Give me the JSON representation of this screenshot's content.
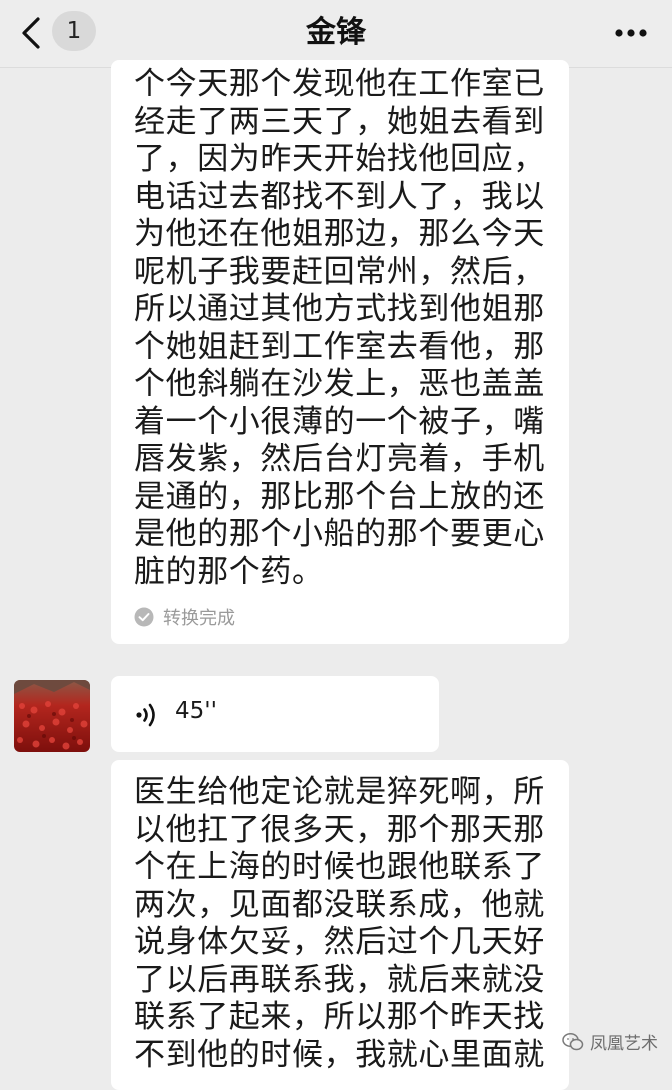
{
  "header": {
    "unread_count": "1",
    "title": "金锋"
  },
  "messages": [
    {
      "type": "transcript",
      "text": "个今天那个发现他在工作室已经走了两三天了，她姐去看到了，因为昨天开始找他回应，电话过去都找不到人了，我以为他还在他姐那边，那么今天呢机子我要赶回常州，然后，所以通过其他方式找到他姐那个她姐赶到工作室去看他，那个他斜躺在沙发上，恶也盖盖着一个小很薄的一个被子，嘴唇发紫，然后台灯亮着，手机是通的，那比那个台上放的还是他的那个小船的那个要更心脏的那个药。",
      "status": "转换完成"
    },
    {
      "type": "voice",
      "duration": "45''"
    },
    {
      "type": "transcript",
      "text": "医生给他定论就是猝死啊，所以他扛了很多天，那个那天那个在上海的时候也跟他联系了两次，见面都没联系成，他就说身体欠妥，然后过个几天好了以后再联系我，就后来就没联系了起来，所以那个昨天找不到他的时候，我就心里面就"
    }
  ],
  "watermark": "凤凰艺术",
  "icons": [
    "back-chevron-icon",
    "more-options-icon",
    "check-circle-icon",
    "voice-wave-icon",
    "wechat-icon"
  ]
}
